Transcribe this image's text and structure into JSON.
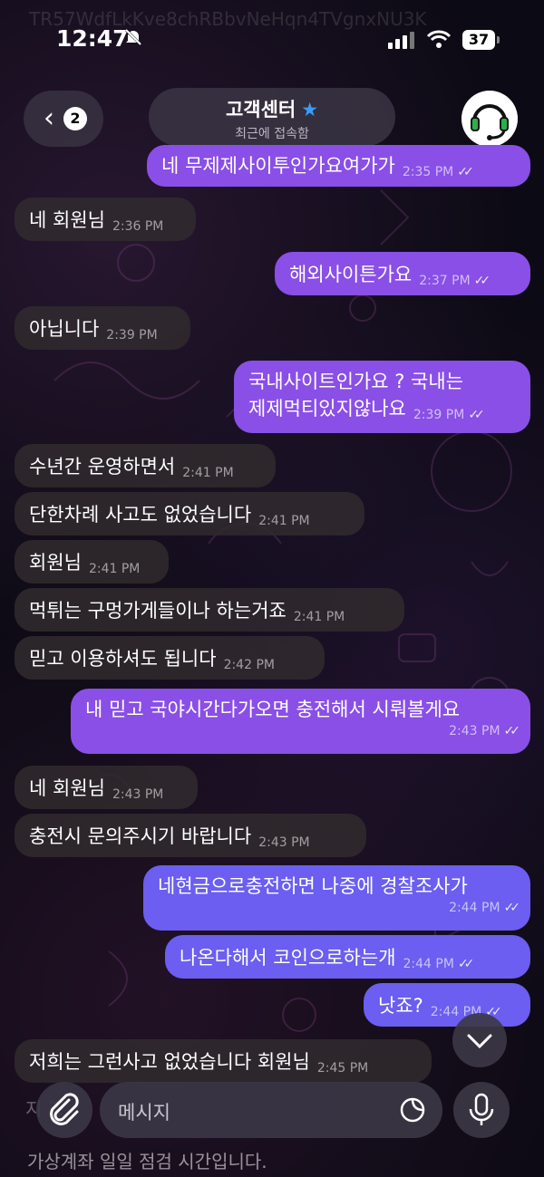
{
  "status_bar": {
    "time": "12:47",
    "battery": "37"
  },
  "ghost_text": "TR57WdfLkKve8chRBbvNeHqn4TVgnxNU3K",
  "header": {
    "back_count": "2",
    "title": "고객센터",
    "subtitle": "최근에 접속함"
  },
  "messages": [
    {
      "text": "네 무제제사이투인가요여가가",
      "time": "2:35 PM"
    },
    {
      "text": "네 회원님",
      "time": "2:36 PM"
    },
    {
      "text": "해외사이튼가요",
      "time": "2:37 PM"
    },
    {
      "text": "아닙니다",
      "time": "2:39 PM"
    },
    {
      "text": "국내사이트인가요 ? 국내는",
      "text2": "제제먹티있지않나요",
      "time": "2:39 PM"
    },
    {
      "text": "수년간 운영하면서",
      "time": "2:41 PM"
    },
    {
      "text": "단한차례 사고도 없었습니다",
      "time": "2:41 PM"
    },
    {
      "text": "회원님",
      "time": "2:41 PM"
    },
    {
      "text": "먹튀는 구멍가게들이나 하는거죠",
      "time": "2:41 PM"
    },
    {
      "text": "믿고 이용하셔도 됩니다",
      "time": "2:42 PM"
    },
    {
      "text": "내 믿고 국야시간다가오면 충전해서 시뤄볼게요",
      "time": "2:43 PM"
    },
    {
      "text": "네 회원님",
      "time": "2:43 PM"
    },
    {
      "text": "충전시 문의주시기 바랍니다",
      "time": "2:43 PM"
    },
    {
      "text": "네현금으로충전하면 나중에 경찰조사가",
      "time": "2:44 PM"
    },
    {
      "text": "나온다해서 코인으로하는개",
      "time": "2:44 PM"
    },
    {
      "text": "낫죠?",
      "time": "2:44 PM"
    },
    {
      "text": "저희는 그런사고 없었습니다 회원님",
      "time": "2:45 PM"
    }
  ],
  "partial_hidden_text": "가상계좌 일일 점검 시간입니다.",
  "partial_hidden_text2": "지 조",
  "input": {
    "placeholder": "메시지"
  },
  "colors": {
    "outgoing": "#8a4fe6",
    "outgoing_blue": "#6b5ef0",
    "incoming": "#302a2e",
    "star": "#3b9bf5"
  }
}
